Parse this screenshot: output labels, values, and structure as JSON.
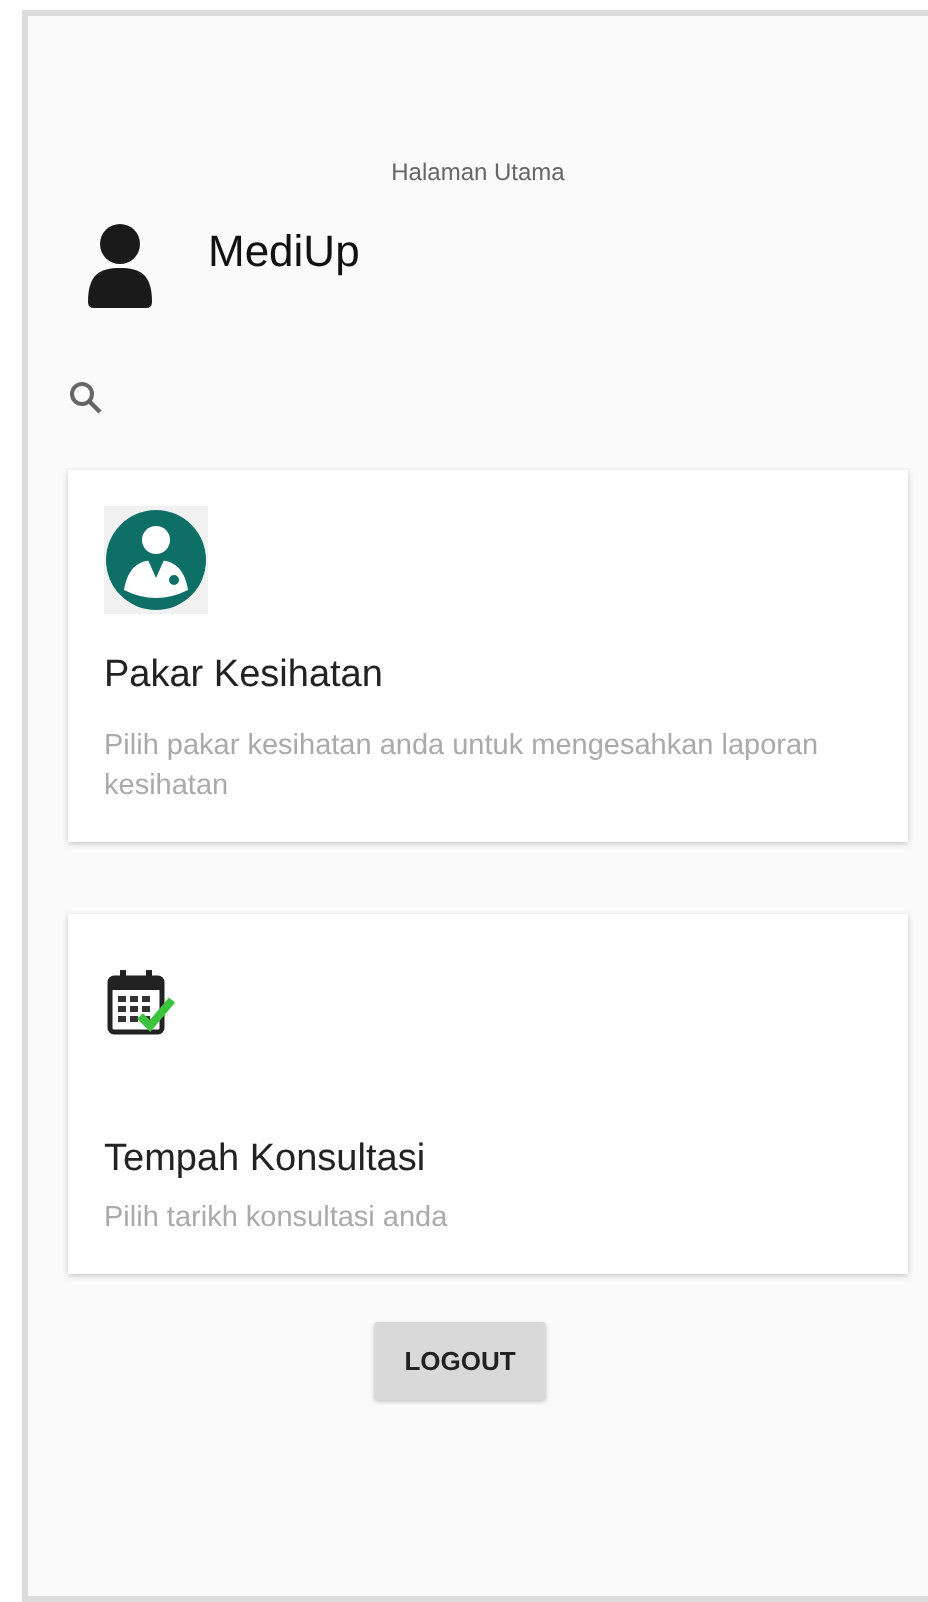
{
  "screen_title": "Halaman Utama",
  "header": {
    "app_name": "MediUp"
  },
  "cards": [
    {
      "kind": "expert",
      "title": "Pakar Kesihatan",
      "description": "Pilih pakar kesihatan anda untuk mengesahkan laporan kesihatan"
    },
    {
      "kind": "booking",
      "title": "Tempah Konsultasi",
      "description": "Pilih tarikh konsultasi anda"
    }
  ],
  "logout_button": "LOGOUT"
}
